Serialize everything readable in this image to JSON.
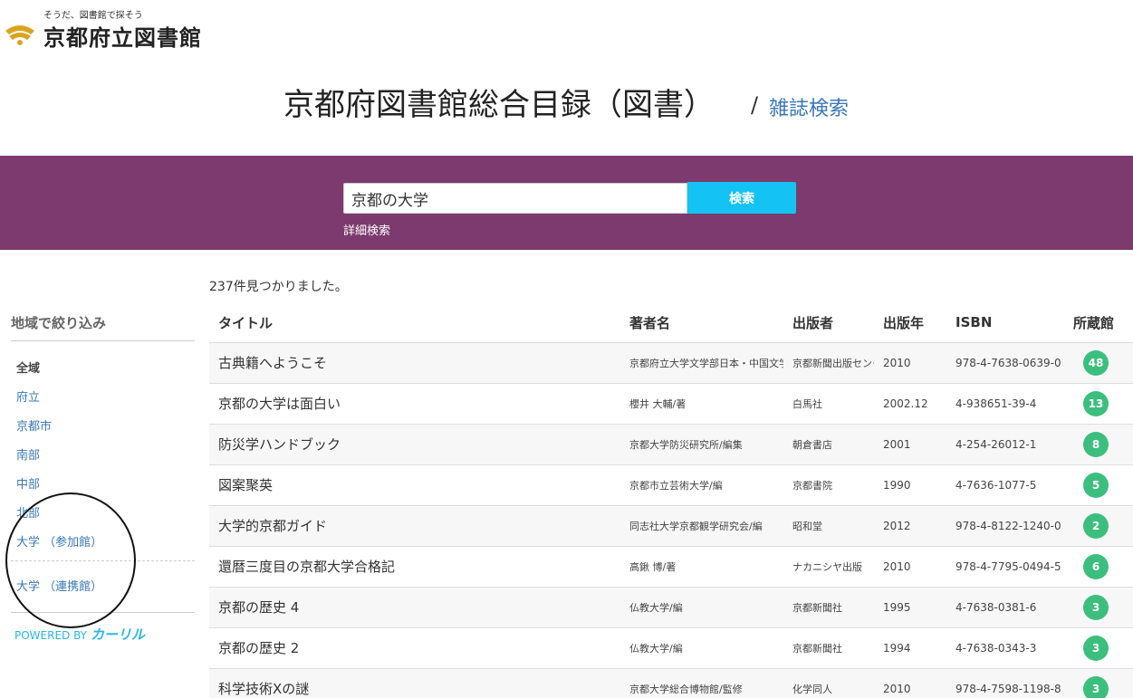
{
  "header": {
    "logo_tagline": "そうだ、図書館で探そう",
    "logo_name": "京都府立図書館",
    "page_title": "京都府図書館総合目録（図書）",
    "title_separator": "/",
    "magazine_search_link": "雑誌検索"
  },
  "search": {
    "query": "京都の大学",
    "button_label": "検索",
    "advanced_link": "詳細検索"
  },
  "sidebar": {
    "heading": "地域で絞り込み",
    "items": [
      {
        "label": "全域",
        "active": true
      },
      {
        "label": "府立",
        "active": false
      },
      {
        "label": "京都市",
        "active": false
      },
      {
        "label": "南部",
        "active": false
      },
      {
        "label": "中部",
        "active": false
      },
      {
        "label": "北部",
        "active": false
      },
      {
        "label": "大学 （参加館）",
        "active": false
      },
      {
        "label": "大学 （連携館）",
        "active": false
      }
    ],
    "powered_by": "POWERED BY",
    "powered_brand": "カーリル"
  },
  "results": {
    "count_text": "237件見つかりました。",
    "columns": {
      "title": "タイトル",
      "author": "著者名",
      "publisher": "出版者",
      "year": "出版年",
      "isbn": "ISBN",
      "holdings": "所蔵館"
    },
    "rows": [
      {
        "title": "古典籍へようこそ",
        "author": "京都府立大学文学部日本・中国文学科",
        "publisher": "京都新聞出版センター",
        "year": "2010",
        "isbn": "978-4-7638-0639-0",
        "holdings": "48"
      },
      {
        "title": "京都の大学は面白い",
        "author": "櫻井 大輔/著",
        "publisher": "白馬社",
        "year": "2002.12",
        "isbn": "4-938651-39-4",
        "holdings": "13"
      },
      {
        "title": "防災学ハンドブック",
        "author": "京都大学防災研究所/編集",
        "publisher": "朝倉書店",
        "year": "2001",
        "isbn": "4-254-26012-1",
        "holdings": "8"
      },
      {
        "title": "図案聚英",
        "author": "京都市立芸術大学/編",
        "publisher": "京都書院",
        "year": "1990",
        "isbn": "4-7636-1077-5",
        "holdings": "5"
      },
      {
        "title": "大学的京都ガイド",
        "author": "同志社大学京都観学研究会/編",
        "publisher": "昭和堂",
        "year": "2012",
        "isbn": "978-4-8122-1240-0",
        "holdings": "2"
      },
      {
        "title": "還暦三度目の京都大学合格記",
        "author": "高鍬 博/著",
        "publisher": "ナカニシヤ出版",
        "year": "2010",
        "isbn": "978-4-7795-0494-5",
        "holdings": "6"
      },
      {
        "title": "京都の歴史 4",
        "author": "仏教大学/編",
        "publisher": "京都新聞社",
        "year": "1995",
        "isbn": "4-7638-0381-6",
        "holdings": "3"
      },
      {
        "title": "京都の歴史 2",
        "author": "仏教大学/編",
        "publisher": "京都新聞社",
        "year": "1994",
        "isbn": "4-7638-0343-3",
        "holdings": "3"
      },
      {
        "title": "科学技術Xの謎",
        "author": "京都大学総合博物館/監修",
        "publisher": "化学同人",
        "year": "2010",
        "isbn": "978-4-7598-1198-8",
        "holdings": "3"
      }
    ]
  },
  "colors": {
    "search_band": "#7c3a6e",
    "search_button": "#14c2f4",
    "link": "#3b78b8",
    "badge": "#3cbf7e",
    "logo_gold": "#d9a520"
  }
}
